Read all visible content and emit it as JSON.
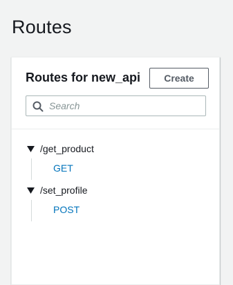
{
  "page": {
    "title": "Routes"
  },
  "panel": {
    "title": "Routes for new_api",
    "create_label": "Create",
    "search_placeholder": "Search"
  },
  "routes": [
    {
      "path": "/get_product",
      "methods": [
        "GET"
      ]
    },
    {
      "path": "/set_profile",
      "methods": [
        "POST"
      ]
    }
  ],
  "icons": {
    "search": "search-icon",
    "caret": "caret-down-icon"
  },
  "colors": {
    "link": "#0073bb",
    "background": "#f2f3f3",
    "button_border": "#545b64"
  }
}
